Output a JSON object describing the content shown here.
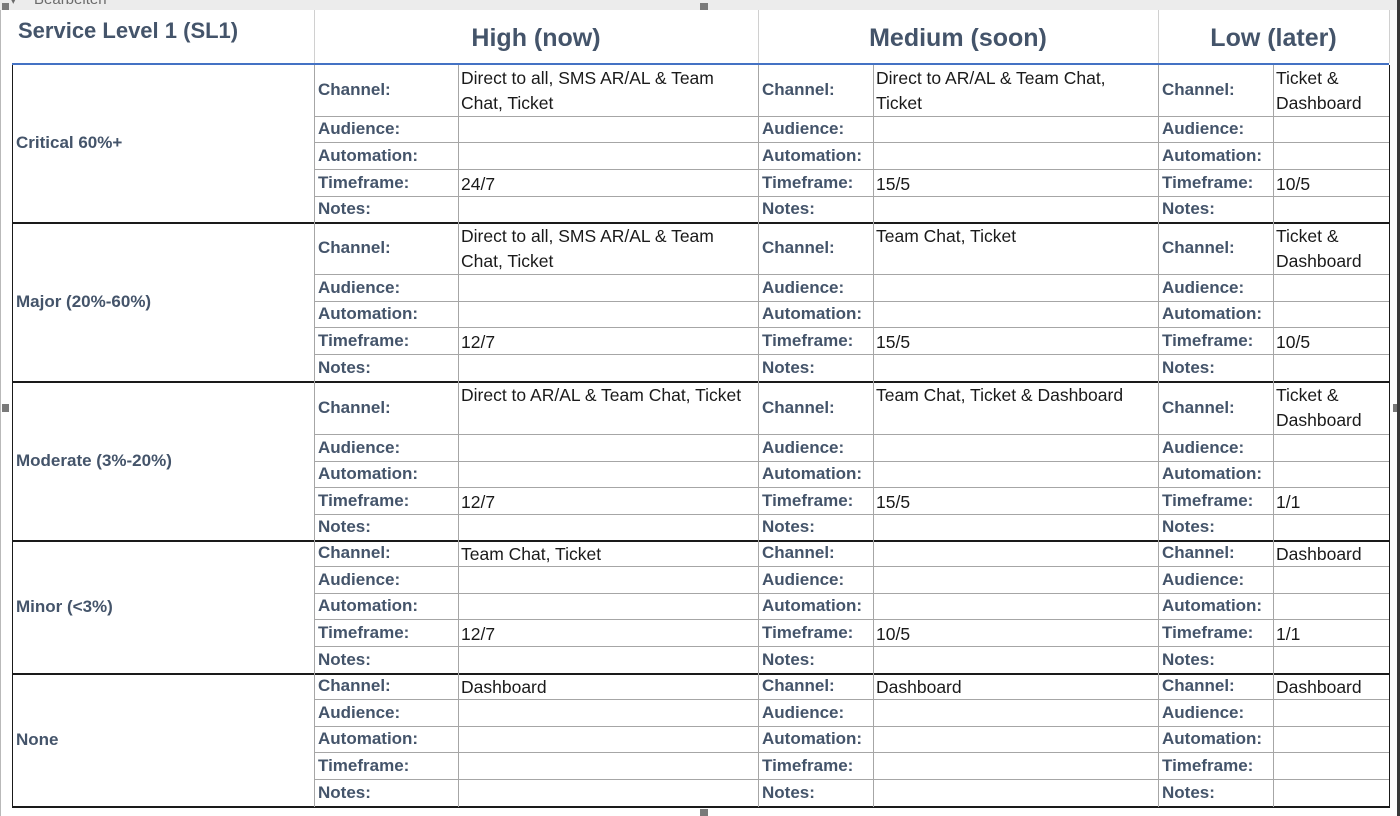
{
  "window": {
    "title_fragment": "Bearbeiten"
  },
  "sheet": {
    "title": "Service Level 1 (SL1)",
    "columns": [
      "High (now)",
      "Medium (soon)",
      "Low (later)"
    ],
    "field_labels": [
      "Channel:",
      "Audience:",
      "Automation:",
      "Timeframe:",
      "Notes:"
    ],
    "groups": [
      {
        "name": "Critical 60%+",
        "values": [
          [
            "Direct to all, SMS AR/AL & Team Chat, Ticket",
            "",
            "",
            "24/7",
            ""
          ],
          [
            "Direct to AR/AL & Team Chat, Ticket",
            "",
            "",
            "15/5",
            ""
          ],
          [
            "Ticket & Dashboard",
            "",
            "",
            "10/5",
            ""
          ]
        ]
      },
      {
        "name": "Major (20%-60%)",
        "values": [
          [
            "Direct to all, SMS AR/AL & Team Chat, Ticket",
            "",
            "",
            "12/7",
            ""
          ],
          [
            "Team Chat, Ticket",
            "",
            "",
            "15/5",
            ""
          ],
          [
            "Ticket & Dashboard",
            "",
            "",
            "10/5",
            ""
          ]
        ]
      },
      {
        "name": "Moderate (3%-20%)",
        "values": [
          [
            "Direct to AR/AL & Team Chat, Ticket",
            "",
            "",
            "12/7",
            ""
          ],
          [
            "Team Chat, Ticket & Dashboard",
            "",
            "",
            "15/5",
            ""
          ],
          [
            "Ticket & Dashboard",
            "",
            "",
            "1/1",
            ""
          ]
        ]
      },
      {
        "name": "Minor (<3%)",
        "values": [
          [
            "Team Chat, Ticket",
            "",
            "",
            "12/7",
            ""
          ],
          [
            "",
            "",
            "",
            "10/5",
            ""
          ],
          [
            "Dashboard",
            "",
            "",
            "1/1",
            ""
          ]
        ]
      },
      {
        "name": "None",
        "values": [
          [
            "Dashboard",
            "",
            "",
            "",
            ""
          ],
          [
            "Dashboard",
            "",
            "",
            "",
            ""
          ],
          [
            "Dashboard",
            "",
            "",
            "",
            ""
          ]
        ]
      }
    ]
  }
}
